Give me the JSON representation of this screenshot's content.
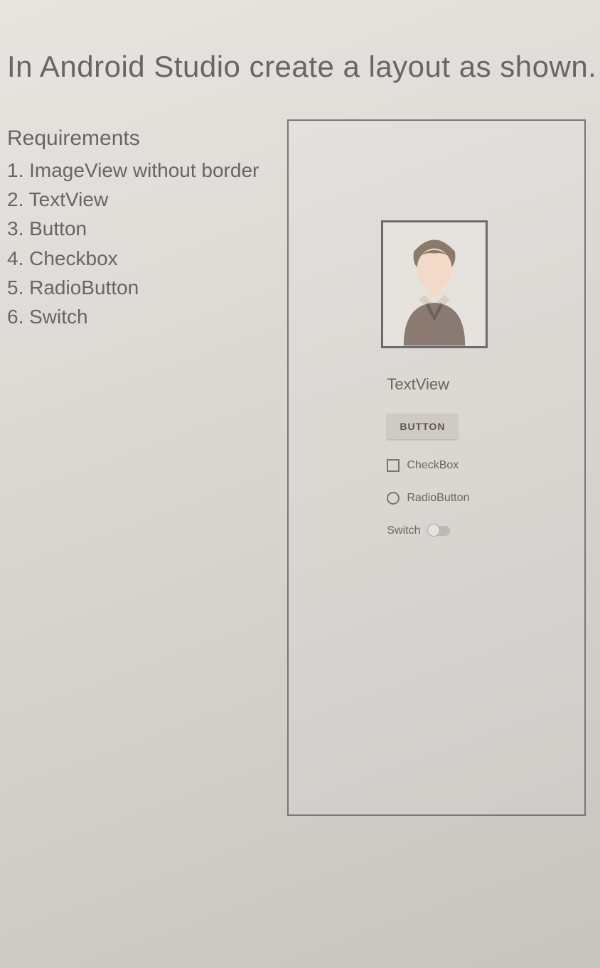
{
  "title": "In Android Studio create a layout as shown.",
  "requirements": {
    "heading": "Requirements",
    "items": [
      "1. ImageView without border",
      "2. TextView",
      "3. Button",
      "4. Checkbox",
      "5. RadioButton",
      "6. Switch"
    ]
  },
  "preview": {
    "image_icon": "person-avatar-icon",
    "textview_label": "TextView",
    "button_label": "BUTTON",
    "checkbox_label": "CheckBox",
    "radiobutton_label": "RadioButton",
    "switch_label": "Switch"
  }
}
